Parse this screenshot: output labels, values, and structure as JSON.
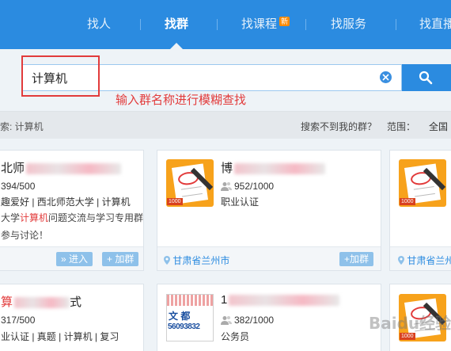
{
  "nav": {
    "items": [
      {
        "label": "找人",
        "active": false
      },
      {
        "label": "找群",
        "active": true
      },
      {
        "label": "找课程",
        "active": false,
        "badge": "新"
      },
      {
        "label": "找服务",
        "active": false
      },
      {
        "label": "找直播",
        "active": false
      }
    ],
    "colors": {
      "bar": "#2b8be0",
      "badge": "#ff8a00"
    }
  },
  "search": {
    "value": "计算机",
    "hint": "输入群名称进行模糊查找",
    "clear_icon": "clear-circle-icon",
    "button_icon": "search-icon"
  },
  "filter": {
    "left": "索: 计算机",
    "not_found_link": "搜索不到我的群？",
    "range_label": "范围：",
    "range_value": "全国"
  },
  "cards": [
    {
      "name_prefix": "北师",
      "name_suffix": "",
      "count": "394/500",
      "tags": "趣爱好 | 西北师范大学 | 计算机",
      "desc_line1_pre": "大学",
      "desc_line1_hl": "计算机",
      "desc_line1_post": "问题交流与学习专用群",
      "desc_line2": "参与讨论！",
      "join_label": "» 进入",
      "add_label": "+ 加群"
    },
    {
      "name_prefix": "博",
      "name_suffix": "",
      "count": "952/1000",
      "tags": "职业认证",
      "location": "甘肃省兰州市",
      "add_label": "+加群",
      "avatar_badge": "1000"
    },
    {
      "location": "甘肃省兰州市",
      "avatar_badge": "1000"
    },
    {
      "name_prefix": "算",
      "name_suffix": "式",
      "count": "317/500",
      "tags": "业认证 | 真题 | 计算机 | 复习"
    },
    {
      "name_prefix": "1",
      "count": "382/1000",
      "tags": "公务员",
      "ad_line1": "文 都",
      "ad_line2": "56093832"
    },
    {
      "avatar_badge": "1000"
    }
  ],
  "watermark": "Baidu经验"
}
